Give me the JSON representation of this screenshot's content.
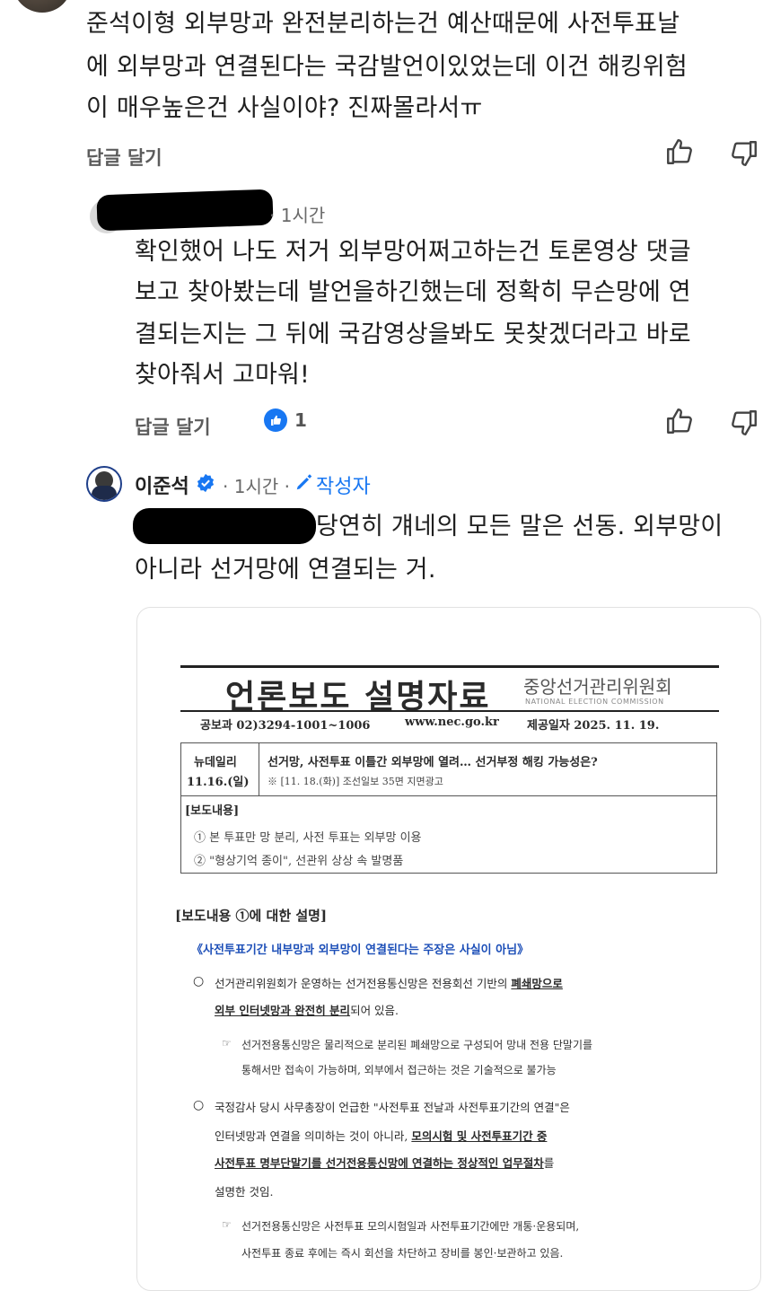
{
  "comment1": {
    "text_line1": "준석이형 외부망과 완전분리하는건 예산때문에 사전투표날",
    "text_line2": "에 외부망과 연결된다는 국감발언이있었는데 이건 해킹위험",
    "text_line3": "이 매우높은건 사실이야? 진짜몰라서ㅠ",
    "reply_label": "답글 달기"
  },
  "comment2": {
    "time": "· 1시간",
    "text_line1": "확인했어 나도 저거 외부망어쩌고하는건 토론영상 댓글",
    "text_line2": "보고 찾아봤는데 발언을하긴했는데 정확히 무슨망에 연",
    "text_line3": "결되는지는 그 뒤에 국감영상을봐도 못찾겠더라고 바로",
    "text_line4": "찾아줘서 고마워!",
    "reply_label": "답글 달기",
    "like_count": "1"
  },
  "comment3": {
    "author": "이준석",
    "time": "· 1시간 ·",
    "author_badge": "작성자",
    "text_line1": "당연히 걔네의 모든 말은 선동. 외부망이",
    "text_line2": "아니라 선거망에 연결되는 거."
  },
  "document": {
    "title": "언론보도 설명자료",
    "org_name": "중앙선거관리위원회",
    "org_name_en": "NATIONAL ELECTION COMMISSION",
    "contact": "공보과 02)3294-1001~1006",
    "website": "www.nec.go.kr",
    "date": "제공일자 2025. 11. 19.",
    "source_outlet": "뉴데일리",
    "source_date": "11.16.(일)",
    "headline": "선거망, 사전투표 이틀간 외부망에 열려… 선거부정 해킹 가능성은?",
    "note": "※ [11. 18.(화)] 조선일보 35면 지면광고",
    "section_label": "[보도내용]",
    "item1": "① 본 투표만 망 분리, 사전 투표는 외부망 이용",
    "item2": "② \"형상기억 종이\", 선관위 상상 속 발명품",
    "explanation_heading": "[보도내용 ①에 대한 설명]",
    "claim": "《사전투표기간 내부망과 외부망이 연결된다는 주장은 사실이 아님》",
    "p1_a": "선거관리위원회가 운영하는 선거전용통신망은 전용회선 기반의",
    "p1_b": "폐쇄망으로",
    "p1_c": "외부 인터넷망과 완전히 분리",
    "p1_d": "되어 있음.",
    "p1_sub_a": "선거전용통신망은 물리적으로 분리된 폐쇄망으로 구성되어 망내 전용 단말기를",
    "p1_sub_b": "통해서만 접속이 가능하며, 외부에서 접근하는 것은 기술적으로 불가능",
    "p2_a": "국정감사 당시 사무총장이 언급한 \"사전투표 전날과 사전투표기간의 연결\"은",
    "p2_b": "인터넷망과 연결을 의미하는 것이 아니라,",
    "p2_c": "모의시험 및 사전투표기간 중",
    "p2_d": "사전투표 명부단말기를 선거전용통신망에 연결하는 정상적인 업무절차",
    "p2_e": "를",
    "p2_f": "설명한 것임.",
    "p2_sub_a": "선거전용통신망은 사전투표 모의시험일과 사전투표기간에만 개통·운용되며,",
    "p2_sub_b": "사전투표 종료 후에는 즉시 회선을 차단하고 장비를 봉인·보관하고 있음."
  },
  "colors": {
    "accent_blue": "#0a66d8",
    "verified": "#1877f2",
    "text": "#1f1f1f",
    "muted": "#6a6a6a"
  }
}
